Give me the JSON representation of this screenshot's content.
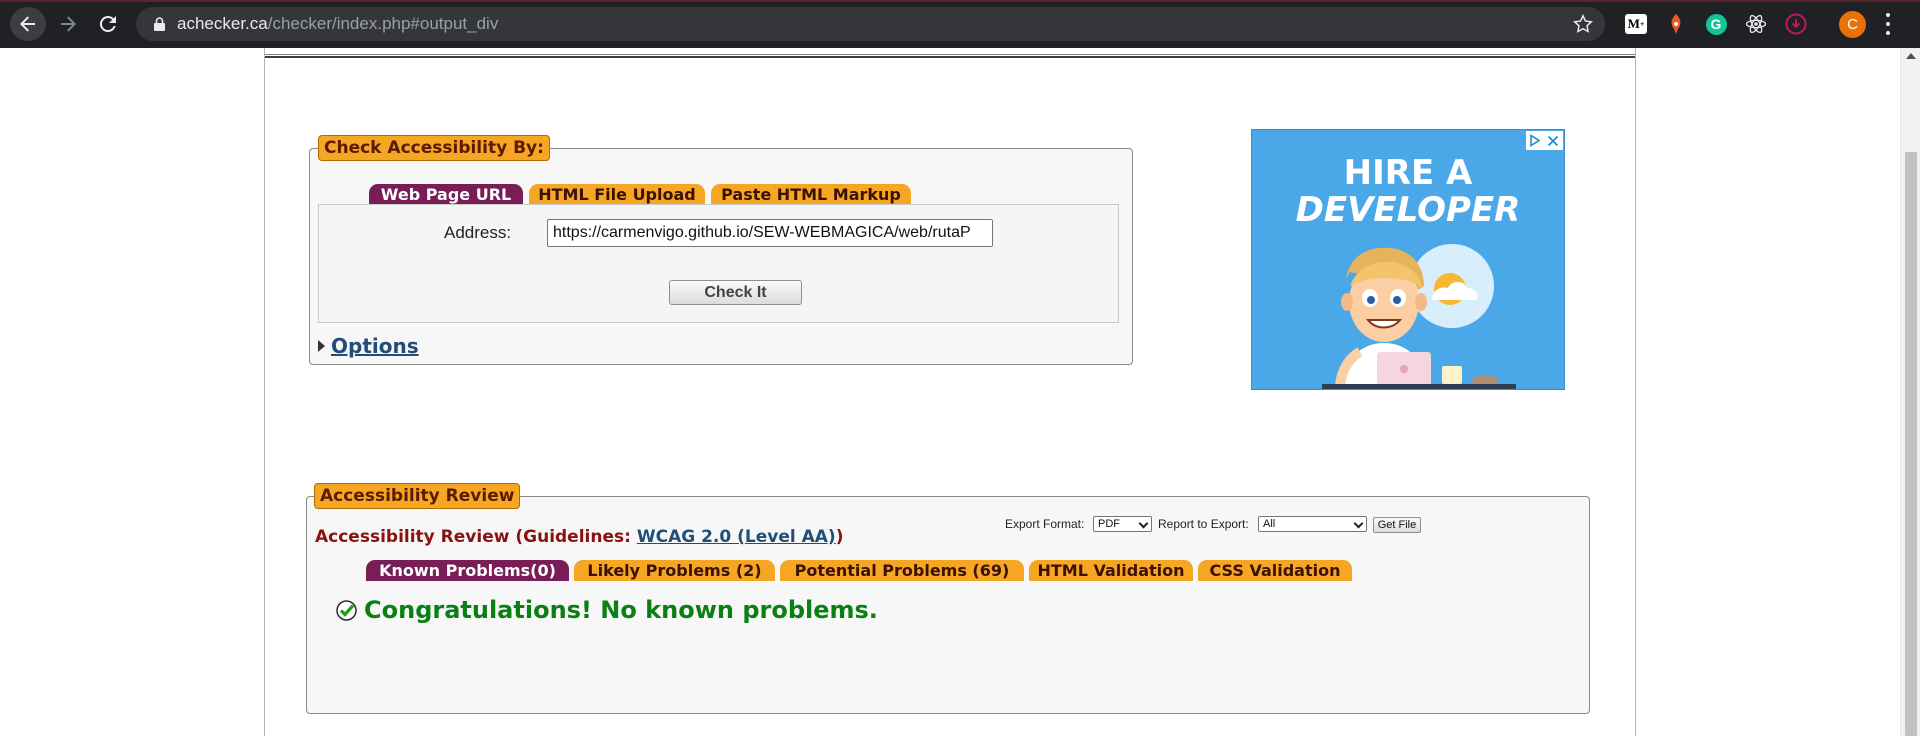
{
  "browser": {
    "url_host": "achecker.ca",
    "url_path": "/checker/index.php#output_div",
    "profile_initial": "C",
    "extensions": [
      "medium-icon",
      "leaf-extension-icon",
      "grammarly-icon",
      "react-devtools-icon",
      "download-extension-icon"
    ]
  },
  "check_section": {
    "legend": "Check Accessibility By:",
    "tabs": [
      {
        "label": "Web Page URL",
        "active": true
      },
      {
        "label": "HTML File Upload",
        "active": false
      },
      {
        "label": "Paste HTML Markup",
        "active": false
      }
    ],
    "address_label": "Address:",
    "address_value": "https://carmenvigo.github.io/SEW-WEBMAGICA/web/rutaP",
    "check_button": "Check It",
    "options_link": "Options"
  },
  "ad": {
    "line1": "HIRE A",
    "line2": "DEVELOPER"
  },
  "review_section": {
    "legend": "Accessibility Review",
    "title_prefix": "Accessibility Review (Guidelines: ",
    "guideline_link": "WCAG 2.0 (Level AA)",
    "title_suffix": ")",
    "export_format_label": "Export Format:",
    "export_format_value": "PDF",
    "report_label": "Report to Export:",
    "report_value": "All",
    "get_file_button": "Get File",
    "tabs": [
      {
        "label": "Known Problems(0)",
        "active": true
      },
      {
        "label": "Likely Problems (2)",
        "active": false
      },
      {
        "label": "Potential Problems (69)",
        "active": false
      },
      {
        "label": "HTML Validation",
        "active": false
      },
      {
        "label": "CSS Validation",
        "active": false
      }
    ],
    "result_message": "Congratulations! No known problems."
  },
  "colors": {
    "tab_active": "#781d56",
    "tab_inactive": "#f5a623",
    "success": "#0a8014",
    "review_title": "#8b1111"
  }
}
